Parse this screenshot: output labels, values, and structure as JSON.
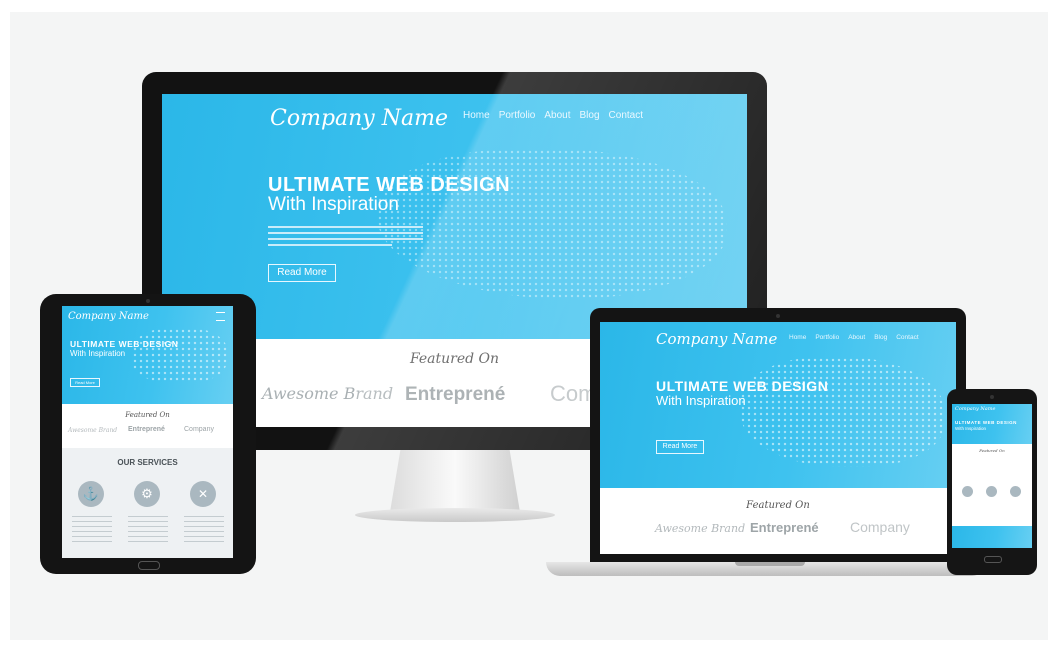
{
  "site": {
    "company": "Company Name",
    "nav": [
      "Home",
      "Portfolio",
      "About",
      "Blog",
      "Contact"
    ],
    "hero_title": "ULTIMATE WEB DESIGN",
    "hero_subtitle": "With Inspiration",
    "read_more": "Read More",
    "featured": "Featured On",
    "brands": [
      "Awesome Brand",
      "Entreprené",
      "Company"
    ],
    "services_title": "OUR SERVICES"
  },
  "icons": [
    "anchor-icon",
    "gear-icon",
    "tools-icon",
    "menu-icon",
    "camera-icon",
    "home-button-icon"
  ],
  "colors": {
    "accent": "#2bb7e8",
    "bezel": "#141414",
    "background": "#f4f5f5"
  }
}
